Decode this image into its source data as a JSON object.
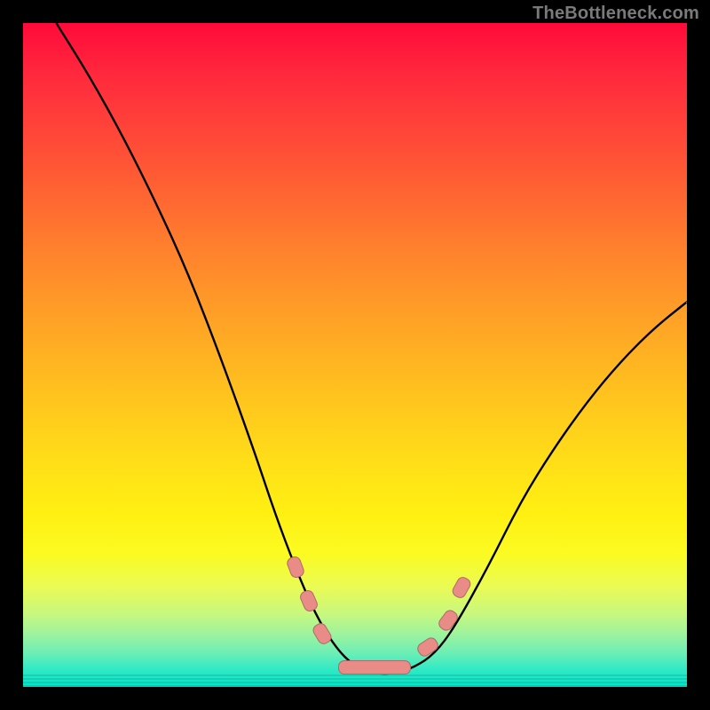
{
  "watermark": "TheBottleneck.com",
  "chart_data": {
    "type": "line",
    "title": "",
    "xlabel": "",
    "ylabel": "",
    "xlim": [
      0,
      100
    ],
    "ylim": [
      0,
      100
    ],
    "grid": false,
    "legend": false,
    "background_gradient": {
      "direction": "vertical",
      "stops": [
        {
          "pos": 0,
          "color": "#ff0a3a"
        },
        {
          "pos": 20,
          "color": "#ff5136"
        },
        {
          "pos": 45,
          "color": "#ffa326"
        },
        {
          "pos": 66,
          "color": "#ffde18"
        },
        {
          "pos": 85,
          "color": "#e9fb55"
        },
        {
          "pos": 100,
          "color": "#00e6c9"
        }
      ]
    },
    "series": [
      {
        "name": "bottleneck-curve",
        "x": [
          5,
          10,
          15,
          20,
          25,
          30,
          35,
          38,
          41,
          44,
          47,
          50,
          53,
          56,
          59,
          62,
          65,
          70,
          75,
          80,
          85,
          90,
          95,
          100
        ],
        "y": [
          100,
          92,
          83,
          73,
          62,
          49,
          35,
          26,
          18,
          11,
          6,
          3,
          2,
          2,
          3,
          5,
          9,
          18,
          28,
          36,
          43,
          49,
          54,
          58
        ]
      }
    ],
    "markers": [
      {
        "x": 41,
        "y": 18,
        "type": "pill-v"
      },
      {
        "x": 43,
        "y": 13,
        "type": "pill-v"
      },
      {
        "x": 45,
        "y": 8,
        "type": "pill-v"
      },
      {
        "x": 53,
        "y": 3,
        "type": "pill-h"
      },
      {
        "x": 61,
        "y": 6,
        "type": "pill-v"
      },
      {
        "x": 64,
        "y": 10,
        "type": "pill-v"
      },
      {
        "x": 66,
        "y": 15,
        "type": "pill-v"
      }
    ]
  }
}
